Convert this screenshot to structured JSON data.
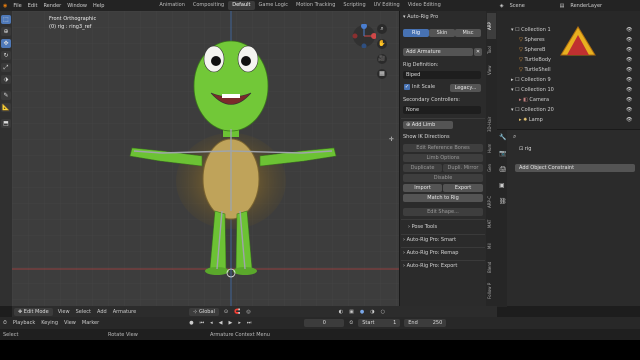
{
  "menu": {
    "file": "File",
    "edit": "Edit",
    "render": "Render",
    "window": "Window",
    "help": "Help"
  },
  "workspace_tabs": [
    "Animation",
    "Compositing",
    "Default",
    "Game Logic",
    "Motion Tracking",
    "Scripting",
    "UV Editing",
    "Video Editing"
  ],
  "active_tab": "Default",
  "scene_name": "Scene",
  "render_layer": "RenderLayer",
  "viewport": {
    "view_name": "Front Orthographic",
    "object_info": "(0) rig : ring3_ref"
  },
  "npanel": {
    "title": "Auto-Rig Pro",
    "tabs": {
      "big": "Rig",
      "skin": "Skin",
      "misc": "Misc"
    },
    "add_armature": "Add Armature",
    "rig_definition_label": "Rig Definition:",
    "rig_definition_value": "Biped",
    "init_scale": "Init Scale",
    "legacy": "Legacy...",
    "secondary_label": "Secondary Controllers:",
    "secondary_value": "None",
    "add_limb": "Add Limb",
    "show_ik": "Show IK Directions",
    "edit_ref": "Edit Reference Bones",
    "limb_options": "Limb Options",
    "duplicate": "Duplicate",
    "dupli_mirror": "Dupli. Mirror",
    "disable": "Disable",
    "import": "Import",
    "export": "Export",
    "match_to_rig": "Match to Rig",
    "edit_shape": "Edit Shape...",
    "pose_tools": "Pose Tools",
    "smart": "Auto-Rig Pro: Smart",
    "remap": "Auto-Rig Pro: Remap",
    "export_section": "Auto-Rig Pro: Export"
  },
  "side_tabs": [
    "ARP",
    "Tool",
    "View",
    "3D-Hair",
    "Hum",
    "Gen",
    "ARP-C",
    "MAT",
    "Mil",
    "Blend",
    "Follow P"
  ],
  "outliner": {
    "rows": [
      "Collection 1",
      "Spheres",
      "SphereB",
      "TurtleBody",
      "TurtleShell",
      "Collection 9",
      "Collection 10",
      "Camera",
      "Collection 20",
      "Lamp",
      "Collection"
    ]
  },
  "props": {
    "bone_name": "rig",
    "add_constraint": "Add Object Constraint"
  },
  "header3d": {
    "mode": "Edit Mode",
    "view": "View",
    "select": "Select",
    "add": "Add",
    "armature": "Armature",
    "orientation": "Global"
  },
  "timeline": {
    "playback": "Playback",
    "keying": "Keying",
    "view": "View",
    "marker": "Marker",
    "current_frame": "0",
    "start_label": "Start",
    "start_value": "1",
    "end_label": "End",
    "end_value": "250"
  },
  "statusbar": {
    "select": "Select",
    "rotate": "Rotate View",
    "context": "Armature Context Menu"
  },
  "colors": {
    "accent": "#4772b3",
    "background": "#3d3d3d",
    "turtle_skin": "#5cb030",
    "shell": "#8a6b2a"
  }
}
